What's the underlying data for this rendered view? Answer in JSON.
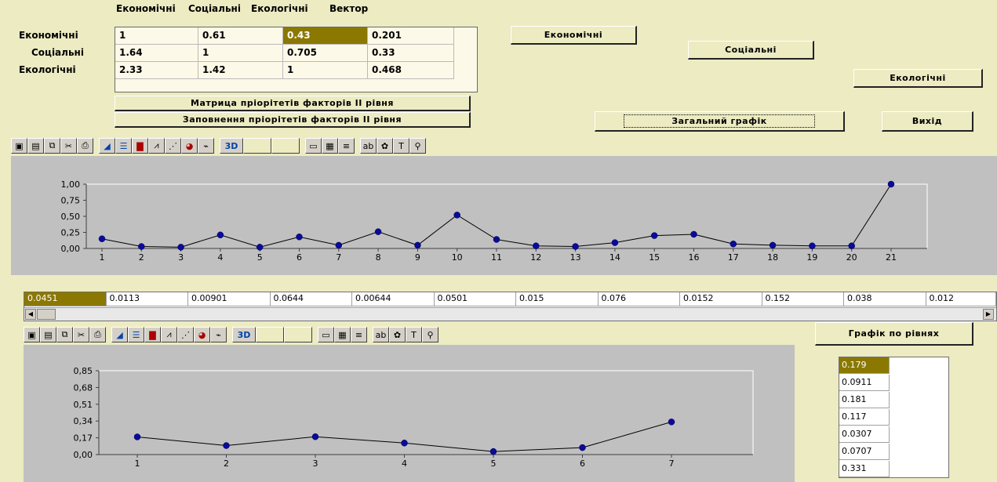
{
  "matrix": {
    "col_headers": [
      "Економічні",
      "Соціальні",
      "Екологічні",
      "Вектор"
    ],
    "row_headers": [
      "Економічні",
      "Соціальні",
      "Екологічні"
    ],
    "rows": [
      [
        "1",
        "0.61",
        "0.43",
        "0.201"
      ],
      [
        "1.64",
        "1",
        "0.705",
        "0.33"
      ],
      [
        "2.33",
        "1.42",
        "1",
        "0.468"
      ]
    ]
  },
  "buttons": {
    "matrix_priorities": "Матрица пріорітетів факторів ІІ рівня",
    "fill_priorities": "Заповнення пріорітетів факторів ІІ рівня",
    "economic": "Економічні",
    "social": "Соціальні",
    "ecological": "Екологічні",
    "general_chart": "Загальний графік",
    "exit": "Вихід",
    "chart_by_levels": "Графік по рівнях"
  },
  "toolbar_icons": [
    "save-icon",
    "save-as-icon",
    "copy-icon",
    "cut-icon",
    "print-icon",
    "area-chart-icon",
    "bar-chart-icon",
    "column-chart-icon",
    "line-chart-icon",
    "scatter-chart-icon",
    "pie-chart-icon",
    "xy-chart-icon",
    "3d-icon",
    "blank-icon",
    "blank-icon",
    "data-icon",
    "grid-icon",
    "lines-icon",
    "text-icon",
    "palette-icon",
    "font-icon",
    "zoom-icon"
  ],
  "strip_values": [
    "0.0451",
    "0.0113",
    "0.00901",
    "0.0644",
    "0.00644",
    "0.0501",
    "0.015",
    "0.076",
    "0.0152",
    "0.152",
    "0.038",
    "0.012"
  ],
  "level_values": [
    "0.179",
    "0.0911",
    "0.181",
    "0.117",
    "0.0307",
    "0.0707",
    "0.331"
  ],
  "chart_data": [
    {
      "type": "line",
      "x": [
        1,
        2,
        3,
        4,
        5,
        6,
        7,
        8,
        9,
        10,
        11,
        12,
        13,
        14,
        15,
        16,
        17,
        18,
        19,
        20,
        21
      ],
      "series": [
        {
          "values": [
            0.15,
            0.03,
            0.02,
            0.21,
            0.02,
            0.18,
            0.05,
            0.26,
            0.05,
            0.52,
            0.14,
            0.04,
            0.03,
            0.09,
            0.2,
            0.22,
            0.07,
            0.05,
            0.04,
            0.04,
            1.0
          ]
        }
      ],
      "ylim": [
        0,
        1
      ],
      "yticks": [
        "1,00",
        "0,75",
        "0,50",
        "0,25",
        "0,00"
      ],
      "xticks": [
        "1",
        "2",
        "3",
        "4",
        "5",
        "6",
        "7",
        "8",
        "9",
        "10",
        "11",
        "12",
        "13",
        "14",
        "15",
        "16",
        "17",
        "18",
        "19",
        "20",
        "21"
      ],
      "grid": false
    },
    {
      "type": "line",
      "x": [
        1,
        2,
        3,
        4,
        5,
        6,
        7
      ],
      "series": [
        {
          "values": [
            0.179,
            0.0911,
            0.181,
            0.117,
            0.0307,
            0.0707,
            0.331
          ]
        }
      ],
      "ylim": [
        0,
        0.85
      ],
      "yticks": [
        "0,85",
        "0,68",
        "0,51",
        "0,34",
        "0,17",
        "0,00"
      ],
      "xticks": [
        "1",
        "2",
        "3",
        "4",
        "5",
        "6",
        "7"
      ],
      "grid": false
    }
  ]
}
